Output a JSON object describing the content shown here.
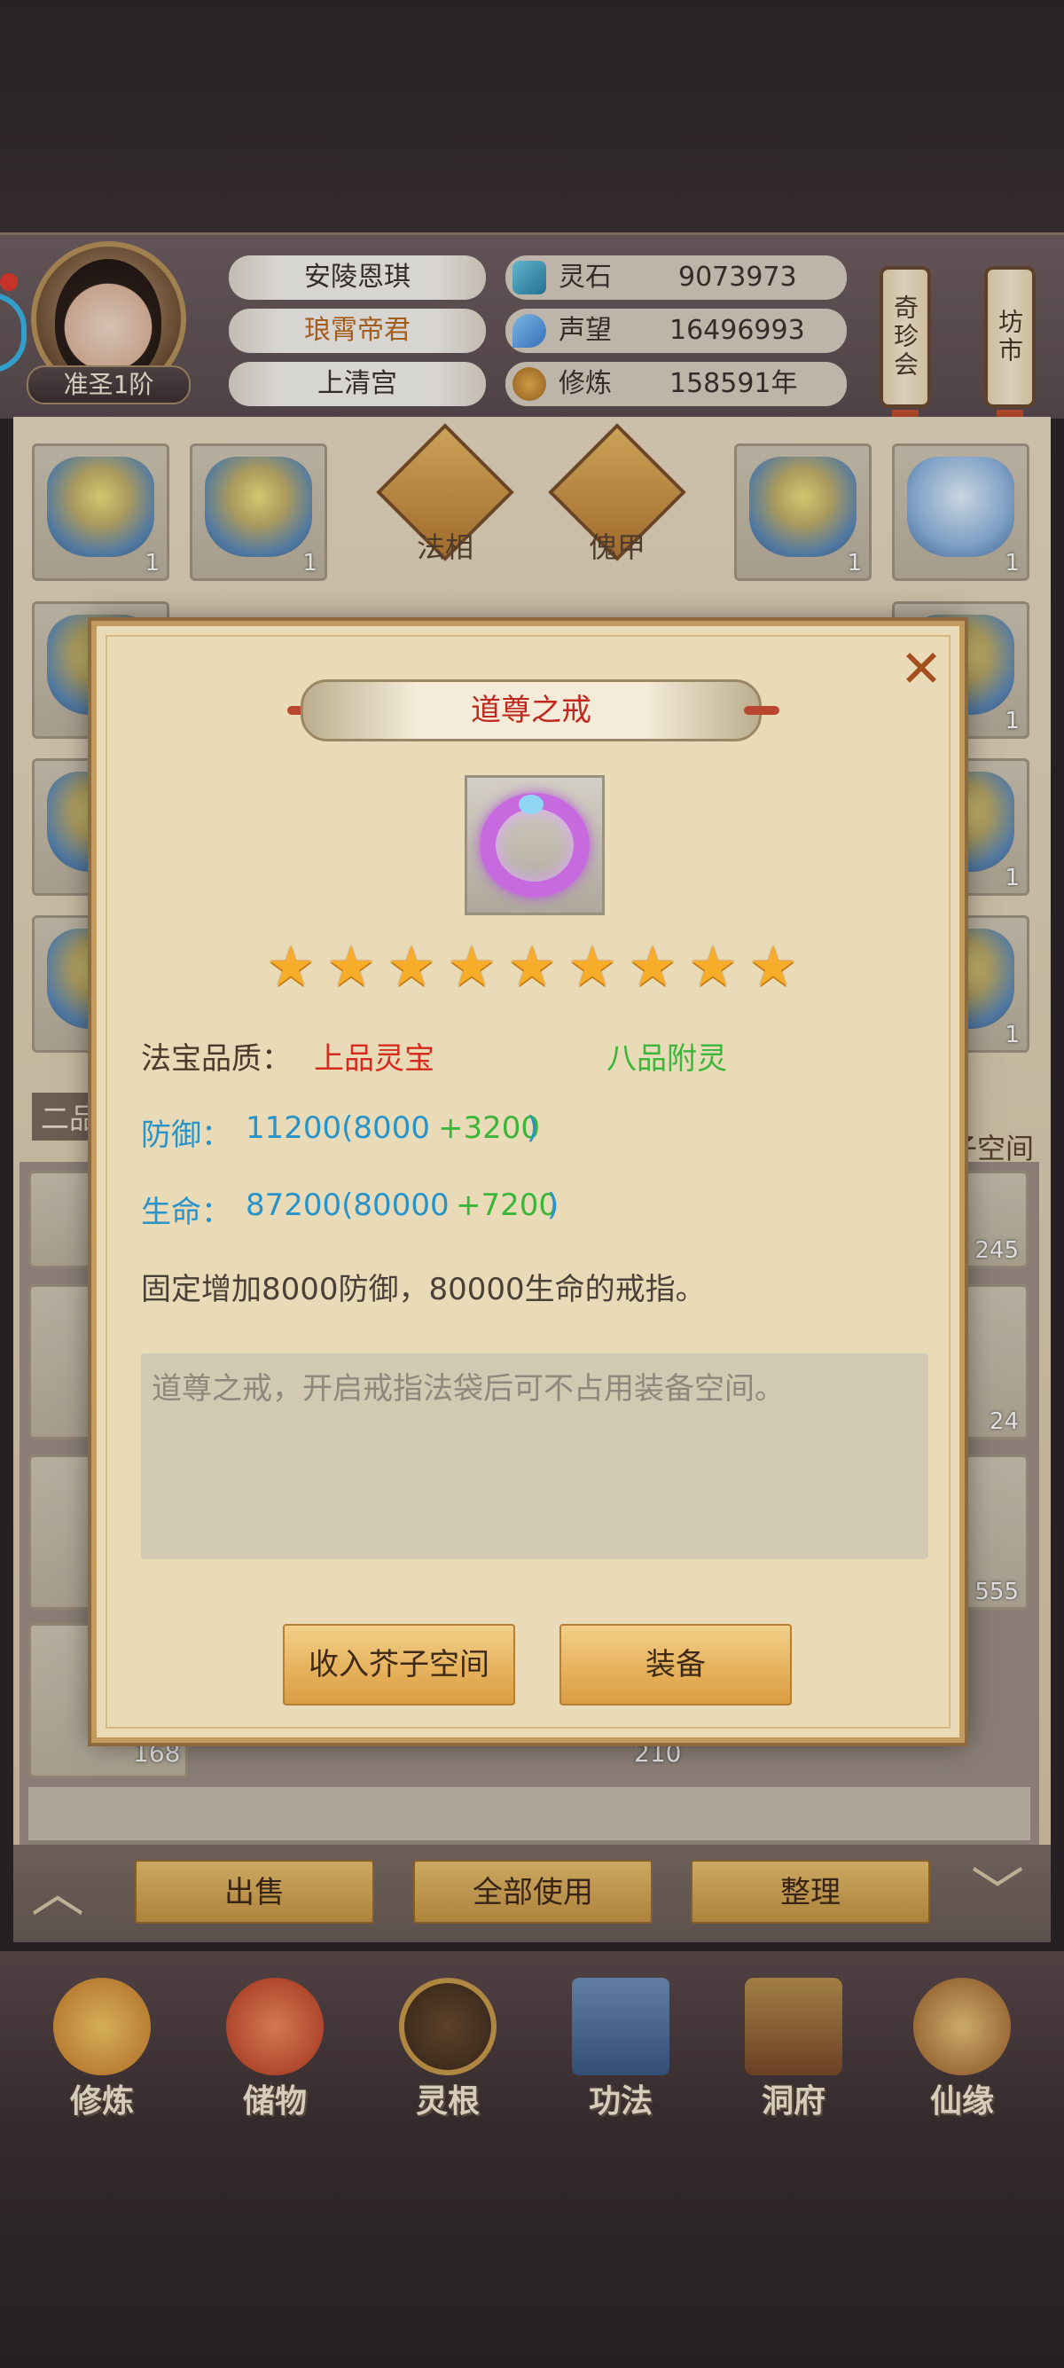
{
  "header": {
    "player_name": "安陵恩琪",
    "title": "琅霄帝君",
    "sect": "上清宫",
    "rank": "准圣1阶",
    "resources": [
      {
        "label": "灵石",
        "value": "9073973",
        "icon": "spirit-stone-icon"
      },
      {
        "label": "声望",
        "value": "16496993",
        "icon": "prestige-icon"
      },
      {
        "label": "修炼",
        "value": "158591年",
        "icon": "cultivation-icon"
      }
    ],
    "side_buttons": [
      "奇珍会",
      "坊市"
    ]
  },
  "inventory": {
    "equip_tabs": [
      "法相",
      "傀甲"
    ],
    "top_slot_counts": [
      "1",
      "1",
      "1",
      "1"
    ],
    "side_counts_right": [
      "1",
      "1",
      "1"
    ],
    "side_label_left": "二品",
    "side_label_right": "子空间",
    "grid_counts": [
      "245",
      "24",
      "555",
      "168",
      "210"
    ]
  },
  "actions": [
    "出售",
    "全部使用",
    "整理"
  ],
  "nav": [
    "修炼",
    "储物",
    "灵根",
    "功法",
    "洞府",
    "仙缘"
  ],
  "modal": {
    "title": "道尊之戒",
    "close": "✕",
    "stars": 9,
    "quality_label": "法宝品质：",
    "quality_value": "上品灵宝",
    "spirit_value": "八品附灵",
    "defense_label": "防御：",
    "defense_total": "11200(8000",
    "defense_plus": "+3200",
    "defense_close": ")",
    "hp_label": "生命：",
    "hp_total": "87200(80000",
    "hp_plus": "+7200",
    "hp_close": ")",
    "fixed_desc": "固定增加8000防御，80000生命的戒指。",
    "lore": "道尊之戒，开启戒指法袋后可不占用装备空间。",
    "btn_store": "收入芥子空间",
    "btn_equip": "装备"
  },
  "colors": {
    "quality": "#d42b1d",
    "spirit": "#3bb53a",
    "stat": "#2893c9",
    "title_red": "#c0281f"
  }
}
